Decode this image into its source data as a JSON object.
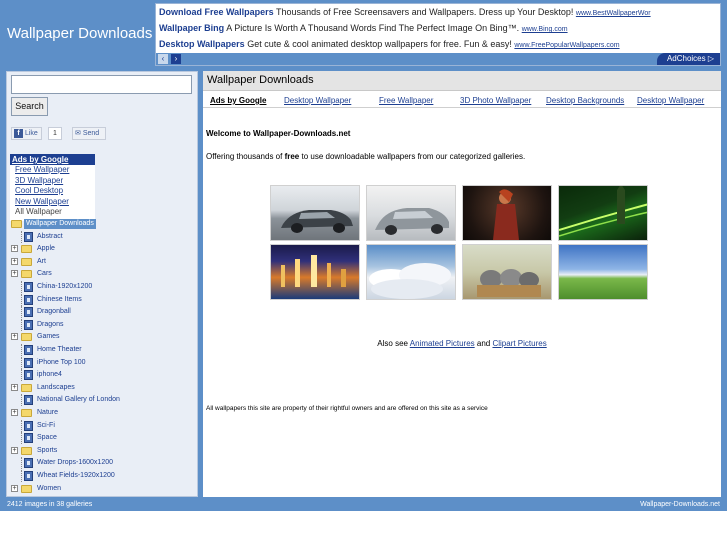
{
  "header": {
    "site_title": "Wallpaper Downloads"
  },
  "top_ad": {
    "lines": [
      {
        "title": "Download Free Wallpapers",
        "text": "Thousands of Free Screensavers and Wallpapers. Dress up Your Desktop!",
        "url": "www.BestWallpaperWor"
      },
      {
        "title": "Wallpaper Bing",
        "text": "A Picture Is Worth A Thousand Words Find The Perfect Image On Bing™.",
        "url": "www.Bing.com"
      },
      {
        "title": "Desktop Wallpapers",
        "text": "Get cute & cool animated desktop wallpapers for free. Fun & easy!",
        "url": "www.FreePopularWallpapers.com"
      }
    ],
    "prev_icon": "‹",
    "next_icon": "›",
    "adchoices": "AdChoices ▷"
  },
  "sidebar": {
    "search_value": "",
    "search_button": "Search",
    "like_label": "Like",
    "like_count": "1",
    "send_label": "Send",
    "ads_header": "Ads by Google",
    "ad_links": [
      "Free Wallpaper",
      "3D Wallpaper",
      "Cool Desktop",
      "New Wallpaper"
    ],
    "all_wallpaper": "All Wallpaper",
    "tree_root": "Wallpaper Downloads",
    "tree": [
      {
        "label": "Abstract",
        "type": "gallery"
      },
      {
        "label": "Apple",
        "type": "folder"
      },
      {
        "label": "Art",
        "type": "folder"
      },
      {
        "label": "Cars",
        "type": "folder"
      },
      {
        "label": "China-1920x1200",
        "type": "gallery"
      },
      {
        "label": "Chinese Items",
        "type": "gallery"
      },
      {
        "label": "Dragonball",
        "type": "gallery"
      },
      {
        "label": "Dragons",
        "type": "gallery"
      },
      {
        "label": "Games",
        "type": "folder"
      },
      {
        "label": "Home Theater",
        "type": "gallery"
      },
      {
        "label": "iPhone Top 100",
        "type": "gallery"
      },
      {
        "label": "iphone4",
        "type": "gallery"
      },
      {
        "label": "Landscapes",
        "type": "folder"
      },
      {
        "label": "National Gallery of London",
        "type": "gallery"
      },
      {
        "label": "Nature",
        "type": "folder"
      },
      {
        "label": "Sci-Fi",
        "type": "gallery"
      },
      {
        "label": "Space",
        "type": "gallery"
      },
      {
        "label": "Sports",
        "type": "folder"
      },
      {
        "label": "Water Drops-1600x1200",
        "type": "gallery"
      },
      {
        "label": "Wheat Fields-1920x1200",
        "type": "gallery"
      },
      {
        "label": "Women",
        "type": "folder"
      }
    ]
  },
  "content": {
    "title": "Wallpaper Downloads",
    "ads_label": "Ads by Google",
    "ads_nav": [
      "Desktop Wallpaper",
      "Free Wallpaper",
      "3D Photo Wallpaper",
      "Desktop Backgrounds",
      "Desktop Wallpaper"
    ],
    "welcome": "Welcome to Wallpaper-Downloads.net",
    "intro_before": "Offering thousands of ",
    "intro_bold": "free",
    "intro_after": " to use downloadable wallpapers from our categorized galleries.",
    "also_see_prefix": "Also see ",
    "animated_link": "Animated Pictures",
    "and_text": " and ",
    "clipart_link": "Clipart Pictures",
    "disclaimer": "All wallpapers this site are property of their rightful owners and are offered on this site as a service"
  },
  "footer": {
    "left": "2412 images in 38 galleries",
    "right": "Wallpaper-Downloads.net"
  },
  "colors": {
    "frame_blue": "#5d8fc8",
    "link_blue": "#1d3f91"
  }
}
